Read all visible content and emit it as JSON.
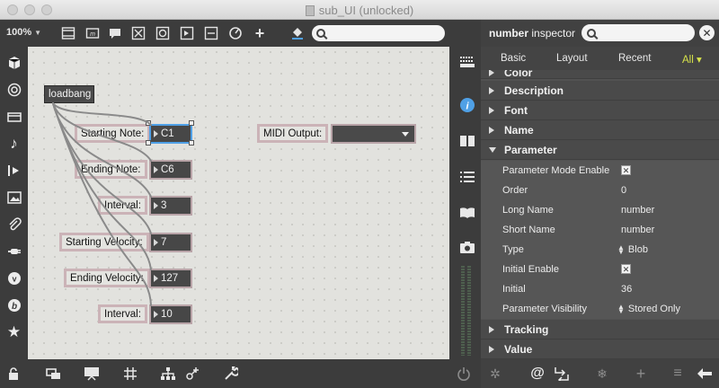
{
  "window": {
    "title": "sub_UI (unlocked)"
  },
  "toolbar": {
    "zoom": "100%",
    "icons": [
      "object-box-icon",
      "message-box-icon",
      "comment-icon",
      "toggle-icon",
      "button-icon",
      "slider-icon",
      "number-icon",
      "dial-icon",
      "add-object-icon",
      "fill-bucket-icon",
      "search-icon"
    ]
  },
  "left_sidebar": {
    "icons": [
      "package-icon",
      "target-icon",
      "device-icon",
      "music-note-icon",
      "media-icon",
      "image-icon",
      "paperclip-icon",
      "plug-icon",
      "vimeo-icon",
      "b-icon",
      "star-icon",
      "lock-icon"
    ]
  },
  "patch": {
    "loadbang": "loadbang",
    "rows": [
      {
        "label": "Starting Note:",
        "value": "C1"
      },
      {
        "label": "Ending Note:",
        "value": "C6"
      },
      {
        "label": "Interval:",
        "value": "3"
      },
      {
        "label": "Starting Velocity:",
        "value": "7"
      },
      {
        "label": "Ending Velocity:",
        "value": "127"
      },
      {
        "label": "Interval:",
        "value": "10"
      }
    ],
    "midi_output_label": "MIDI Output:",
    "midi_output_value": ""
  },
  "inspector": {
    "title_bold": "number",
    "title_rest": " inspector",
    "close": "✕",
    "tabs": [
      "Basic",
      "Layout",
      "Recent",
      "All ▾"
    ],
    "active_tab": "All ▾",
    "partial_section": "Color",
    "sections_top": [
      "Description",
      "Font",
      "Name",
      "Parameter"
    ],
    "parameter_rows": [
      {
        "key": "Parameter Mode Enable",
        "value": "✕",
        "kind": "checkbox"
      },
      {
        "key": "Order",
        "value": "0",
        "kind": "text"
      },
      {
        "key": "Long Name",
        "value": "number",
        "kind": "text"
      },
      {
        "key": "Short Name",
        "value": "number",
        "kind": "text"
      },
      {
        "key": "Type",
        "value": "Blob",
        "kind": "menu"
      },
      {
        "key": "Initial Enable",
        "value": "✕",
        "kind": "checkbox"
      },
      {
        "key": "Initial",
        "value": "36",
        "kind": "text"
      },
      {
        "key": "Parameter Visibility",
        "value": "Stored Only",
        "kind": "menu"
      }
    ],
    "sections_bottom": [
      "Tracking",
      "Value"
    ]
  },
  "colors": {
    "accent_tab": "#d6e24a",
    "selection": "#4fa0e6",
    "comment_border": "#cbb3b7"
  }
}
